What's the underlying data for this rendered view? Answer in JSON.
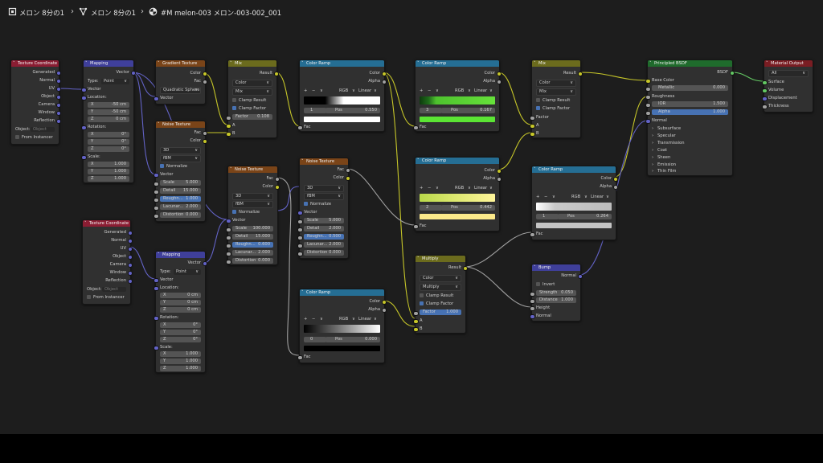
{
  "breadcrumb": {
    "item1": "メロン 8分の1",
    "item2": "メロン 8分の1",
    "item3": "#M melon-003 メロン-003-002_001"
  },
  "common": {
    "generated": "Generated",
    "normal": "Normal",
    "uv": "UV",
    "object": "Object",
    "camera": "Camera",
    "window": "Window",
    "reflection": "Reflection",
    "object_field": "Object:",
    "object_placeholder": "Object",
    "from_instancer": "From Instancer",
    "vector": "Vector",
    "type": "Type:",
    "point": "Point",
    "location": "Location:",
    "rotation": "Rotation:",
    "scale": "Scale:",
    "x": "X",
    "y": "Y",
    "z": "Z",
    "cm0": "0 cm",
    "deg0": "0°",
    "one": "1.000",
    "color": "Color",
    "fac": "Fac",
    "result": "Result",
    "alpha": "Alpha",
    "mix": "Mix",
    "clamp_result": "Clamp Result",
    "clamp_factor": "Clamp Factor",
    "factor": "Factor",
    "a": "A",
    "b": "B",
    "rgb": "RGB",
    "linear": "Linear",
    "pos": "Pos",
    "d3": "3D",
    "fbm": "fBM",
    "normalize": "Normalize",
    "scale_k": "Scale",
    "detail": "Detail",
    "roughness_k": "Roughn...",
    "lacunarity": "Lacunar...",
    "distortion": "Distortion",
    "plus": "+",
    "minus": "−",
    "chev": "∨"
  },
  "nodes": {
    "texcoord1": {
      "title": "Texture Coordinate"
    },
    "texcoord2": {
      "title": "Texture Coordinate"
    },
    "mapping1": {
      "title": "Mapping",
      "loc_x": "-50 cm",
      "loc_y": "-50 cm",
      "loc_z": "0 cm"
    },
    "mapping2": {
      "title": "Mapping"
    },
    "gradient": {
      "title": "Gradient Texture",
      "gradient_type": "Quadratic Sphere"
    },
    "noise1": {
      "title": "Noise Texture",
      "scale": "5.000",
      "detail": "15.000",
      "roughness": "1.000",
      "lacunarity": "2.000",
      "distortion": "0.000"
    },
    "noise2": {
      "title": "Noise Texture",
      "scale": "100.000",
      "detail": "15.000",
      "roughness": "0.600",
      "lacunarity": "2.000",
      "distortion": "0.000"
    },
    "noise3": {
      "title": "Noise Texture",
      "scale": "5.000",
      "detail": "2.000",
      "roughness": "0.500",
      "lacunarity": "2.000",
      "distortion": "0.000"
    },
    "mix1": {
      "title": "Mix",
      "factor": "0.108"
    },
    "ramp1": {
      "title": "Color Ramp",
      "index": "1",
      "pos": "0.550"
    },
    "ramp2": {
      "title": "Color Ramp",
      "index": "3",
      "pos": "0.167"
    },
    "ramp3": {
      "title": "Color Ramp",
      "index": "2",
      "pos": "0.442"
    },
    "ramp4": {
      "title": "Color Ramp",
      "index": "0",
      "pos": "0.000"
    },
    "ramp5": {
      "title": "Color Ramp",
      "index": "1",
      "pos": "0.264"
    },
    "mix2": {
      "title": "Mix"
    },
    "multiply": {
      "title": "Multiply",
      "blend": "Multiply",
      "factor": "1.000"
    },
    "bump": {
      "title": "Bump",
      "invert": "Invert",
      "strength_k": "Strength",
      "strength": "0.050",
      "distance_k": "Distance",
      "distance": "1.000",
      "height": "Height"
    },
    "bsdf": {
      "title": "Principled BSDF",
      "bsdf": "BSDF",
      "base_color": "Base Color",
      "metallic_k": "Metallic",
      "metallic": "0.000",
      "roughness": "Roughness",
      "ior_k": "IOR",
      "ior": "1.500",
      "alpha_k": "Alpha",
      "alpha": "1.000",
      "subsurface": "Subsurface",
      "specular": "Specular",
      "transmission": "Transmission",
      "coat": "Coat",
      "sheen": "Sheen",
      "emission": "Emission",
      "thin_film": "Thin Film"
    },
    "output": {
      "title": "Material Output",
      "target": "All",
      "surface": "Surface",
      "volume": "Volume",
      "displacement": "Displacement",
      "thickness": "Thickness"
    }
  },
  "colors": {
    "input_header": "#8b1d33",
    "vector_header": "#3f3f9a",
    "texture_header": "#7a4418",
    "converter_header": "#256e94",
    "color_header": "#6b6b1d",
    "shader_header": "#1f6b2c",
    "output_header": "#7a1d23",
    "socket_color": "#c7c729",
    "socket_float": "#a1a1a1",
    "socket_vector": "#6363c7",
    "socket_shader": "#63c763"
  }
}
